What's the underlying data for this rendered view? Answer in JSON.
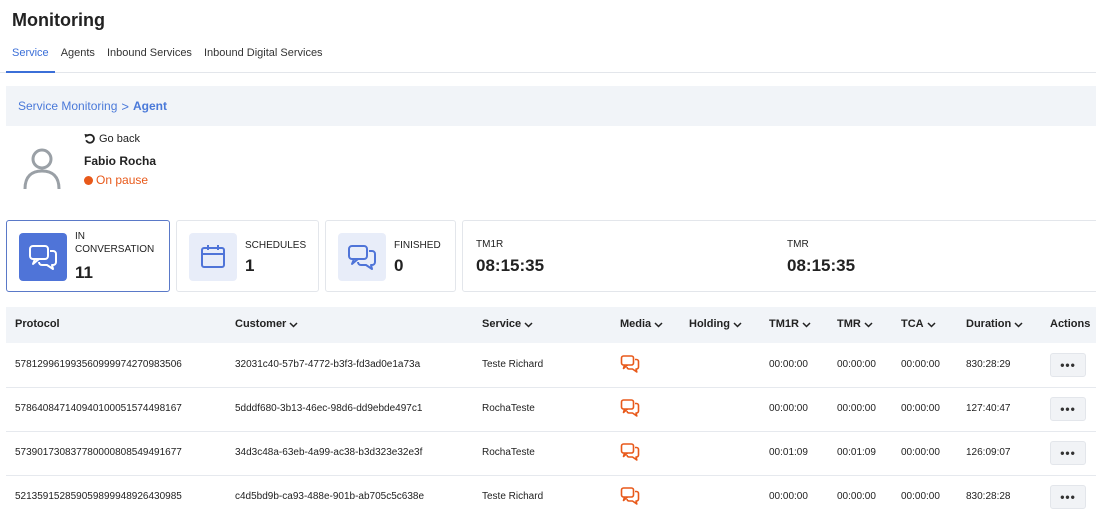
{
  "page": {
    "title": "Monitoring"
  },
  "tabs": [
    {
      "label": "Service",
      "active": true
    },
    {
      "label": "Agents",
      "active": false
    },
    {
      "label": "Inbound Services",
      "active": false
    },
    {
      "label": "Inbound Digital Services",
      "active": false
    }
  ],
  "breadcrumb": {
    "parent": "Service Monitoring",
    "separator": ">",
    "current": "Agent"
  },
  "agent": {
    "go_back": "Go back",
    "name": "Fabio Rocha",
    "status": "On pause",
    "status_color": "#e8591a"
  },
  "cards": [
    {
      "label": "IN CONVERSATION",
      "value": "11",
      "icon": "chat-bubbles-icon"
    },
    {
      "label": "SCHEDULES",
      "value": "1",
      "icon": "calendar-icon"
    },
    {
      "label": "FINISHED",
      "value": "0",
      "icon": "chat-bubbles-icon"
    }
  ],
  "metrics": [
    {
      "label": "TM1R",
      "value": "08:15:35"
    },
    {
      "label": "TMR",
      "value": "08:15:35"
    }
  ],
  "table": {
    "columns": [
      "Protocol",
      "Customer",
      "Service",
      "Media",
      "Holding",
      "TM1R",
      "TMR",
      "TCA",
      "Duration",
      "Actions"
    ],
    "rows": [
      {
        "protocol": "578129961993560999974270983506",
        "customer": "32031c40-57b7-4772-b3f3-fd3ad0e1a73a",
        "service": "Teste Richard",
        "media": "chat-icon",
        "holding": "",
        "tm1r": "00:00:00",
        "tmr": "00:00:00",
        "tca": "00:00:00",
        "duration": "830:28:29",
        "action": "•••"
      },
      {
        "protocol": "578640847140940100051574498167",
        "customer": "5dddf680-3b13-46ec-98d6-dd9ebde497c1",
        "service": "RochaTeste",
        "media": "chat-icon",
        "holding": "",
        "tm1r": "00:00:00",
        "tmr": "00:00:00",
        "tca": "00:00:00",
        "duration": "127:40:47",
        "action": "•••"
      },
      {
        "protocol": "573901730837780000808549491677",
        "customer": "34d3c48a-63eb-4a99-ac38-b3d323e32e3f",
        "service": "RochaTeste",
        "media": "chat-icon",
        "holding": "",
        "tm1r": "00:01:09",
        "tmr": "00:01:09",
        "tca": "00:00:00",
        "duration": "126:09:07",
        "action": "•••"
      },
      {
        "protocol": "521359152859059899948926430985",
        "customer": "c4d5bd9b-ca93-488e-901b-ab705c5c638e",
        "service": "Teste Richard",
        "media": "chat-icon",
        "holding": "",
        "tm1r": "00:00:00",
        "tmr": "00:00:00",
        "tca": "00:00:00",
        "duration": "830:28:28",
        "action": "•••"
      }
    ]
  },
  "colors": {
    "accent": "#3b6fd8",
    "media_icon": "#e8591a",
    "header_bg": "#f1f4f8"
  }
}
